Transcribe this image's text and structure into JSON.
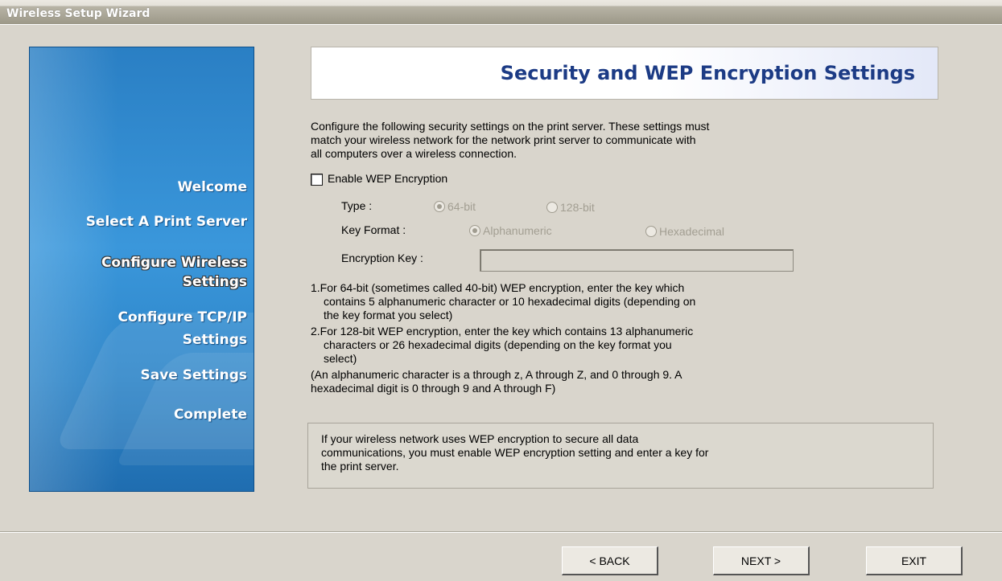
{
  "window": {
    "title": "Wireless Setup Wizard"
  },
  "sidebar": {
    "steps": [
      {
        "label": "Welcome"
      },
      {
        "label": "Select A Print Server"
      },
      {
        "label": "Configure Wireless Settings",
        "line1": "Configure Wireless",
        "line2": "Settings",
        "active": true
      },
      {
        "label": "Configure TCP/IP Settings",
        "line1": "Configure TCP/IP",
        "line2": "Settings"
      },
      {
        "label": "Save Settings"
      },
      {
        "label": "Complete"
      }
    ]
  },
  "header": {
    "title": "Security and WEP Encryption Settings"
  },
  "intro": {
    "line1": "Configure the following security settings on the print server. These settings must",
    "line2": "match your wireless network for the network print server to communicate with",
    "line3": "all computers over a wireless connection."
  },
  "wep": {
    "enable_label": "Enable WEP Encryption",
    "enabled": false,
    "type_label": "Type :",
    "type_options": [
      "64-bit",
      "128-bit"
    ],
    "type_selected": "64-bit",
    "key_format_label": "Key Format :",
    "key_format_options": [
      "Alphanumeric",
      "Hexadecimal"
    ],
    "key_format_selected": "Alphanumeric",
    "key_label": "Encryption Key :",
    "key_value": ""
  },
  "notes": {
    "n1_line1": "1.For 64-bit (sometimes called 40-bit) WEP encryption, enter the key which",
    "n1_line2": "contains 5 alphanumeric character or 10 hexadecimal digits (depending on",
    "n1_line3": "the key format you select)",
    "n2_line1": "2.For 128-bit WEP encryption, enter the key which contains 13 alphanumeric",
    "n2_line2": "characters or 26 hexadecimal digits (depending on the key format you",
    "n2_line3": "select)",
    "n3_line1": "(An alphanumeric character is a through z, A through Z, and 0 through 9. A",
    "n3_line2": "hexadecimal digit is 0 through 9 and A through F)"
  },
  "info": {
    "line1": "If your wireless network uses WEP encryption to secure all data",
    "line2": "communications, you must enable WEP encryption setting and enter a key for",
    "line3": "the print server."
  },
  "buttons": {
    "back": "< BACK",
    "next": "NEXT >",
    "exit": "EXIT"
  }
}
